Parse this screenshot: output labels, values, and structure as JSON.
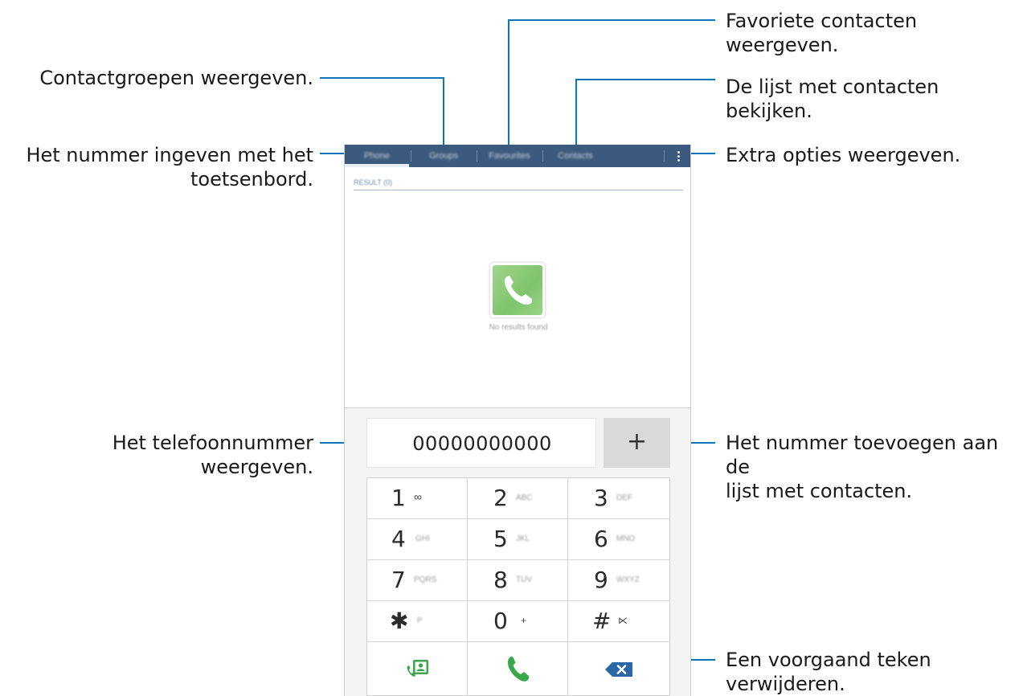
{
  "callouts": {
    "favorites": "Favoriete contacten weergeven.",
    "groups": "Contactgroepen weergeven.",
    "contacts_list": "De lijst met contacten bekijken.",
    "keypad_line1": "Het nummer ingeven met het",
    "keypad_line2": "toetsenbord.",
    "more_options": "Extra opties weergeven.",
    "show_number": "Het telefoonnummer weergeven.",
    "add_line1": "Het nummer toevoegen aan de",
    "add_line2": "lijst met contacten.",
    "delete_line1": "Een voorgaand teken",
    "delete_line2": "verwijderen."
  },
  "tabs": [
    {
      "label": "Phone"
    },
    {
      "label": "Groups"
    },
    {
      "label": "Favourites"
    },
    {
      "label": "Contacts"
    }
  ],
  "results": {
    "section_label": "RESULT (0)",
    "empty_message": "No results found"
  },
  "dialer": {
    "number": "00000000000",
    "add_symbol": "+"
  },
  "keypad": [
    {
      "num": "1",
      "sub": "∞"
    },
    {
      "num": "2",
      "sub": "ABC"
    },
    {
      "num": "3",
      "sub": "DEF"
    },
    {
      "num": "4",
      "sub": "GHI"
    },
    {
      "num": "5",
      "sub": "JKL"
    },
    {
      "num": "6",
      "sub": "MNO"
    },
    {
      "num": "7",
      "sub": "PQRS"
    },
    {
      "num": "8",
      "sub": "TUV"
    },
    {
      "num": "9",
      "sub": "WXYZ"
    },
    {
      "num": "✱",
      "sub": "P"
    },
    {
      "num": "0",
      "sub": "+"
    },
    {
      "num": "#",
      "sub": "⋉"
    }
  ],
  "colors": {
    "callout_line": "#0a77b8",
    "tab_bar": "#3c5a7d",
    "call_green": "#3aa84a",
    "delete_blue": "#2b66a6"
  },
  "icons": {
    "contacts_add": "add-contact-icon",
    "call": "call-icon",
    "delete": "backspace-icon",
    "phone_tile": "phone-app-icon"
  }
}
